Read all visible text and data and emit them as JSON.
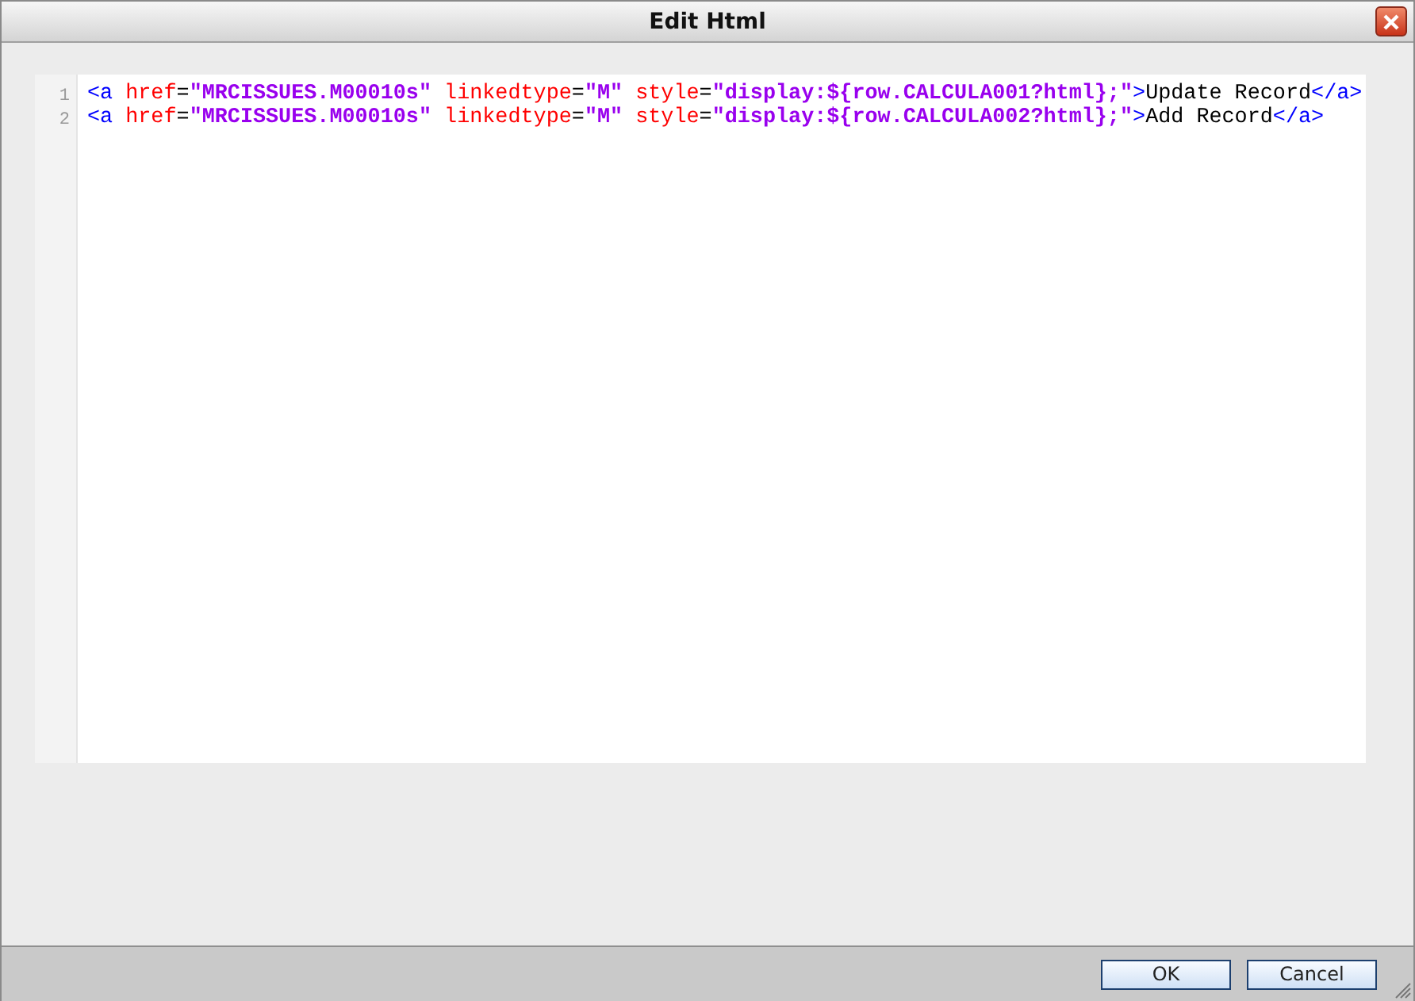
{
  "window": {
    "title": "Edit Html"
  },
  "editor": {
    "lines": [
      {
        "number": "1",
        "tokens": [
          {
            "kind": "tag",
            "text": "<a "
          },
          {
            "kind": "attr",
            "text": "href"
          },
          {
            "kind": "plain",
            "text": "="
          },
          {
            "kind": "string",
            "text": "\"MRCISSUES.M00010s\""
          },
          {
            "kind": "attr",
            "text": " linkedtype"
          },
          {
            "kind": "plain",
            "text": "="
          },
          {
            "kind": "string",
            "text": "\"M\""
          },
          {
            "kind": "attr",
            "text": " style"
          },
          {
            "kind": "plain",
            "text": "="
          },
          {
            "kind": "string",
            "text": "\"display:${row.CALCULA001?html};\""
          },
          {
            "kind": "tag",
            "text": ">"
          },
          {
            "kind": "plain",
            "text": "Update Record"
          },
          {
            "kind": "tag",
            "text": "</a>"
          }
        ]
      },
      {
        "number": "2",
        "tokens": [
          {
            "kind": "tag",
            "text": "<a "
          },
          {
            "kind": "attr",
            "text": "href"
          },
          {
            "kind": "plain",
            "text": "="
          },
          {
            "kind": "string",
            "text": "\"MRCISSUES.M00010s\""
          },
          {
            "kind": "attr",
            "text": " linkedtype"
          },
          {
            "kind": "plain",
            "text": "="
          },
          {
            "kind": "string",
            "text": "\"M\""
          },
          {
            "kind": "attr",
            "text": " style"
          },
          {
            "kind": "plain",
            "text": "="
          },
          {
            "kind": "string",
            "text": "\"display:${row.CALCULA002?html};\""
          },
          {
            "kind": "tag",
            "text": ">"
          },
          {
            "kind": "plain",
            "text": "Add Record"
          },
          {
            "kind": "tag",
            "text": "</a>"
          }
        ]
      }
    ]
  },
  "buttons": [
    "OK",
    "Cancel"
  ]
}
